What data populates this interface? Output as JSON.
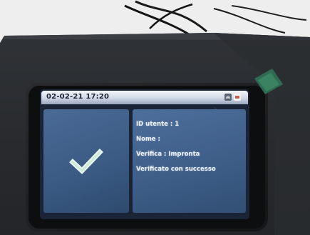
{
  "screen": {
    "datetime": "02-02-21 17:20",
    "status_icons": [
      "fingerprint-icon",
      "card-icon"
    ],
    "result_icon": "checkmark-icon",
    "info_lines": [
      "ID utente : 1",
      "Nome :",
      "Verifica : Impronta",
      "Verificato con successo"
    ]
  },
  "colors": {
    "panel": "#3f5f89",
    "checkmark": "#e9f6ee",
    "topbar": "#dfe6f0"
  }
}
